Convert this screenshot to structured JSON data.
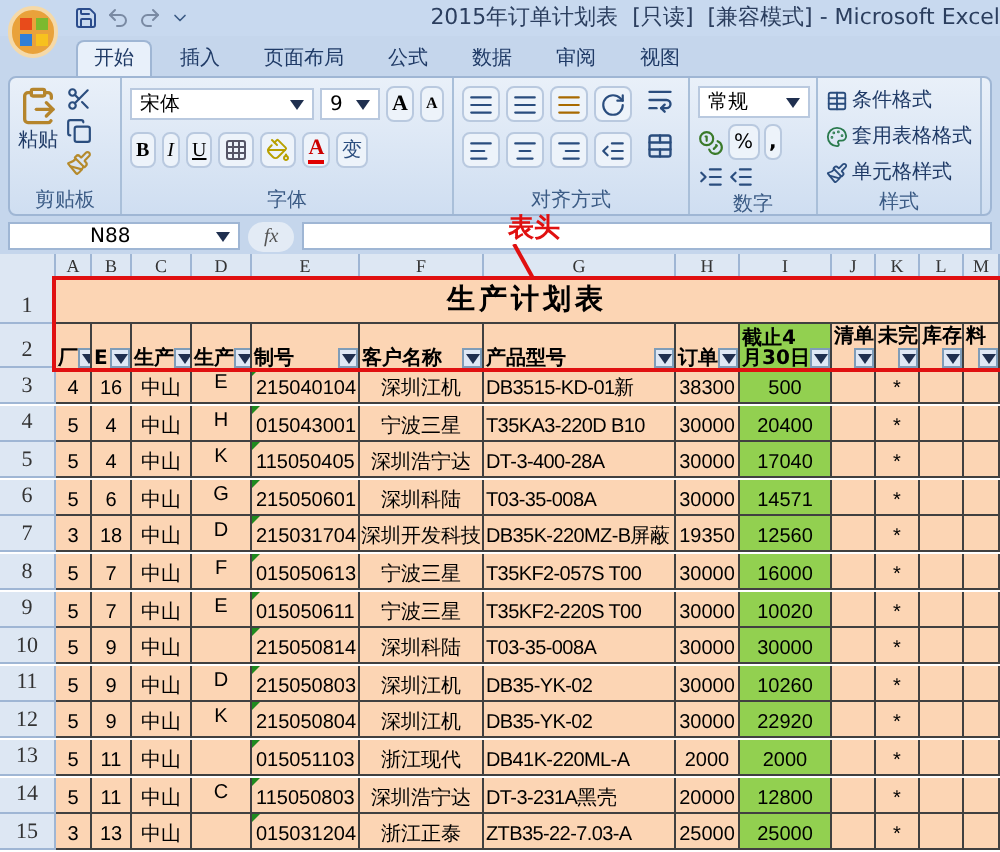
{
  "window": {
    "title": "2015年订单计划表  [只读]  [兼容模式] - Microsoft Excel"
  },
  "ribbon_tabs": [
    {
      "label": "开始",
      "selected": true
    },
    {
      "label": "插入",
      "selected": false
    },
    {
      "label": "页面布局",
      "selected": false
    },
    {
      "label": "公式",
      "selected": false
    },
    {
      "label": "数据",
      "selected": false
    },
    {
      "label": "审阅",
      "selected": false
    },
    {
      "label": "视图",
      "selected": false
    }
  ],
  "ribbon": {
    "clipboard": {
      "paste_label": "粘贴",
      "group_label": "剪贴板"
    },
    "font": {
      "font_name": "宋体",
      "font_size": "9",
      "grow": "A",
      "shrink": "A",
      "bold": "B",
      "italic": "I",
      "underline": "U",
      "font_color": "A",
      "phonetic": "变",
      "group_label": "字体"
    },
    "alignment": {
      "group_label": "对齐方式"
    },
    "number": {
      "format": "常规",
      "percent": "%",
      "comma": ",",
      "group_label": "数字"
    },
    "styles": {
      "items": [
        "条件格式",
        "套用表格格式",
        "单元格样式"
      ],
      "group_label": "样式"
    }
  },
  "formula_bar": {
    "name_box": "N88",
    "fx": "fx"
  },
  "sheet": {
    "column_headers": [
      "A",
      "B",
      "C",
      "D",
      "E",
      "F",
      "G",
      "H",
      "I",
      "J",
      "K",
      "L",
      "M"
    ],
    "title": "生产计划表",
    "header_row": [
      "厂",
      "E",
      "生产",
      "生产",
      "制号",
      "客户名称",
      "产品型号",
      "订单",
      "截止4月30日",
      "清单",
      "未完",
      "库存",
      "料"
    ],
    "rows": [
      {
        "number": "1"
      },
      {
        "number": "2"
      },
      {
        "number": "3",
        "a": "4",
        "b": "16",
        "c": "中山",
        "d": "E",
        "e": "215040104",
        "f": "深圳江机",
        "g": "DB3515-KD-01新",
        "h": "38300",
        "i": "500",
        "k": "*"
      },
      {
        "number": "4",
        "a": "5",
        "b": "4",
        "c": "中山",
        "d": "H",
        "e": "015043001",
        "f": "宁波三星",
        "g": "T35KA3-220D B10",
        "h": "30000",
        "i": "20400",
        "k": "*"
      },
      {
        "number": "5",
        "a": "5",
        "b": "4",
        "c": "中山",
        "d": "K",
        "e": "115050405",
        "f": "深圳浩宁达",
        "g": "DT-3-400-28A",
        "h": "30000",
        "i": "17040",
        "k": "*"
      },
      {
        "number": "6",
        "a": "5",
        "b": "6",
        "c": "中山",
        "d": "G",
        "e": "215050601",
        "f": "深圳科陆",
        "g": "T03-35-008A",
        "h": "30000",
        "i": "14571",
        "k": "*"
      },
      {
        "number": "7",
        "a": "3",
        "b": "18",
        "c": "中山",
        "d": "D",
        "e": "215031704",
        "f": "深圳开发科技",
        "g": "DB35K-220MZ-B屏蔽",
        "h": "19350",
        "i": "12560",
        "k": "*"
      },
      {
        "number": "8",
        "a": "5",
        "b": "7",
        "c": "中山",
        "d": "F",
        "e": "015050613",
        "f": "宁波三星",
        "g": "T35KF2-057S T00",
        "h": "30000",
        "i": "16000",
        "k": "*"
      },
      {
        "number": "9",
        "a": "5",
        "b": "7",
        "c": "中山",
        "d": "E",
        "e": "015050611",
        "f": "宁波三星",
        "g": "T35KF2-220S T00",
        "h": "30000",
        "i": "10020",
        "k": "*"
      },
      {
        "number": "10",
        "a": "5",
        "b": "9",
        "c": "中山",
        "e": "215050814",
        "f": "深圳科陆",
        "g": "T03-35-008A",
        "h": "30000",
        "i": "30000",
        "k": "*"
      },
      {
        "number": "11",
        "a": "5",
        "b": "9",
        "c": "中山",
        "d": "D",
        "e": "215050803",
        "f": "深圳江机",
        "g": "DB35-YK-02",
        "h": "30000",
        "i": "10260",
        "k": "*"
      },
      {
        "number": "12",
        "a": "5",
        "b": "9",
        "c": "中山",
        "d": "K",
        "e": "215050804",
        "f": "深圳江机",
        "g": "DB35-YK-02",
        "h": "30000",
        "i": "22920",
        "k": "*"
      },
      {
        "number": "13",
        "a": "5",
        "b": "11",
        "c": "中山",
        "e": "015051103",
        "f": "浙江现代",
        "g": "DB41K-220ML-A",
        "h": "2000",
        "i": "2000",
        "k": "*"
      },
      {
        "number": "14",
        "a": "5",
        "b": "11",
        "c": "中山",
        "d": "C",
        "e": "115050803",
        "f": "深圳浩宁达",
        "g": "DT-3-231A黑壳",
        "h": "20000",
        "i": "12800",
        "k": "*"
      },
      {
        "number": "15",
        "a": "3",
        "b": "13",
        "c": "中山",
        "e": "015031204",
        "f": "浙江正泰",
        "g": "ZTB35-22-7.03-A",
        "h": "25000",
        "i": "25000",
        "k": "*"
      }
    ]
  },
  "annotation": {
    "label": "表头"
  }
}
